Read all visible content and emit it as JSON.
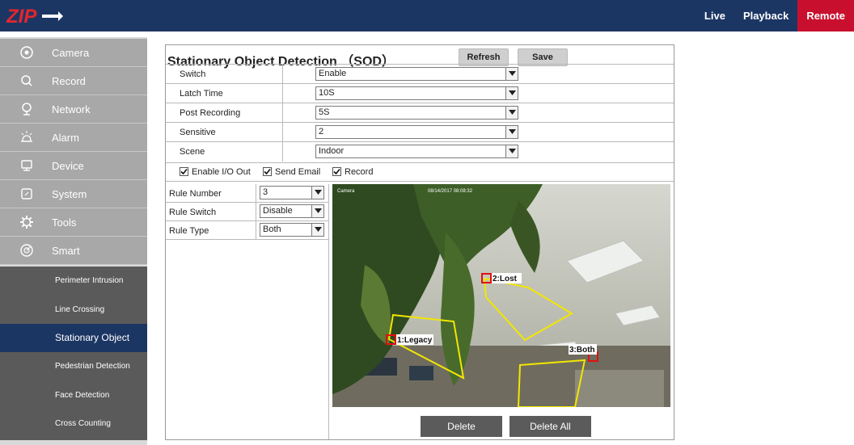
{
  "brand": {
    "logo_text": "ZIP"
  },
  "topnav": {
    "items": [
      "Live",
      "Playback",
      "Remote"
    ],
    "active": "Remote"
  },
  "sidebar": {
    "items": [
      {
        "label": "Camera",
        "icon": "camera-icon"
      },
      {
        "label": "Record",
        "icon": "search-icon"
      },
      {
        "label": "Network",
        "icon": "network-icon"
      },
      {
        "label": "Alarm",
        "icon": "alarm-icon"
      },
      {
        "label": "Device",
        "icon": "device-icon"
      },
      {
        "label": "System",
        "icon": "system-icon"
      },
      {
        "label": "Tools",
        "icon": "gear-icon"
      },
      {
        "label": "Smart",
        "icon": "smart-icon"
      }
    ],
    "sub_items": [
      "Perimeter Intrusion",
      "Line Crossing",
      "Stationary Object",
      "Pedestrian Detection",
      "Face Detection",
      "Cross Counting"
    ],
    "active_sub": "Stationary Object"
  },
  "panel": {
    "title": "Stationary Object Detection （SOD）",
    "refresh_label": "Refresh",
    "save_label": "Save",
    "settings": [
      {
        "label": "Switch",
        "value": "Enable"
      },
      {
        "label": "Latch Time",
        "value": "10S"
      },
      {
        "label": "Post Recording",
        "value": "5S"
      },
      {
        "label": "Sensitive",
        "value": "2"
      },
      {
        "label": "Scene",
        "value": "Indoor"
      }
    ],
    "checkboxes": [
      {
        "label": "Enable I/O Out",
        "checked": true
      },
      {
        "label": "Send Email",
        "checked": true
      },
      {
        "label": "Record",
        "checked": true
      }
    ],
    "rules": [
      {
        "label": "Rule Number",
        "value": "3"
      },
      {
        "label": "Rule Switch",
        "value": "Disable"
      },
      {
        "label": "Rule Type",
        "value": "Both"
      }
    ],
    "video": {
      "osd_camera": "Camera",
      "osd_timestamp": "08/14/2017 08:08:32",
      "zones": [
        "1:Legacy",
        "2:Lost",
        "3:Both"
      ]
    },
    "delete_label": "Delete",
    "delete_all_label": "Delete All"
  },
  "colors": {
    "header_bg": "#1c3664",
    "active_red": "#c8102e",
    "sidebar_item": "#a8a8a8",
    "sidebar_sub": "#5a5a5a",
    "zone_line": "#f2e600",
    "zone_marker": "#e01010"
  }
}
